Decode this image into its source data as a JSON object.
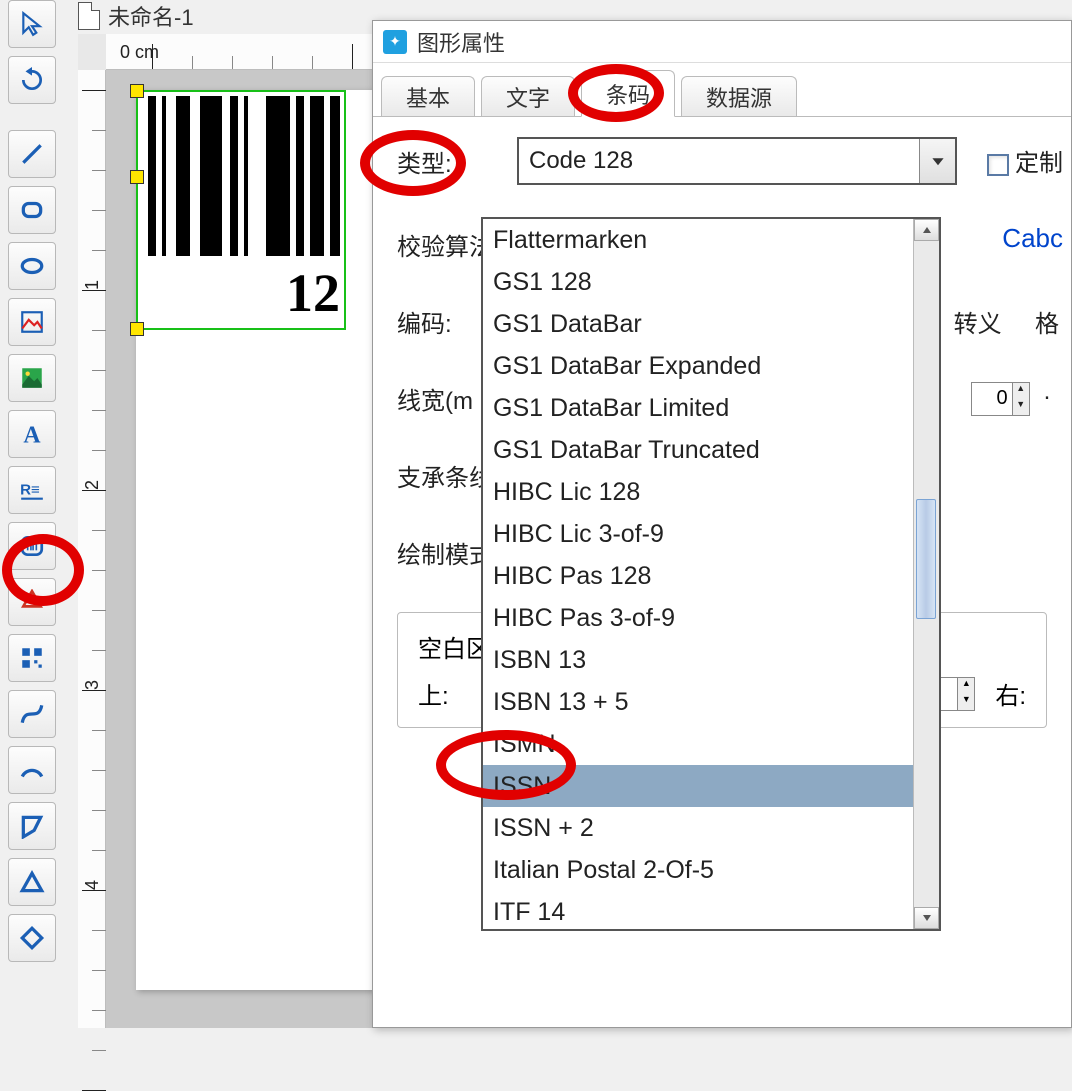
{
  "document": {
    "title": "未命名-1"
  },
  "ruler": {
    "unit_label": "0 cm",
    "marks_v": [
      "1",
      "2",
      "3",
      "4"
    ]
  },
  "barcode_object": {
    "text": "12"
  },
  "dialog": {
    "title": "图形属性",
    "tabs": {
      "basic": "基本",
      "text": "文字",
      "barcode": "条码",
      "datasource": "数据源"
    },
    "labels": {
      "type": "类型:",
      "custom": "定制",
      "check": "校验算法",
      "encode": "编码:",
      "linewidth": "线宽(m",
      "bearer": "支承条线",
      "drawmode": "绘制模式",
      "blank": "空白区",
      "top": "上:",
      "escape": "转义",
      "format": "格",
      "right": "右:",
      "cabc": "Cabc"
    },
    "combo_value": "Code 128",
    "spinner_value": "0",
    "dropdown_items": [
      "Flattermarken",
      "GS1 128",
      "GS1 DataBar",
      "GS1 DataBar Expanded",
      "GS1 DataBar Limited",
      "GS1 DataBar Truncated",
      "HIBC Lic 128",
      "HIBC Lic 3-of-9",
      "HIBC Pas 128",
      "HIBC Pas 3-of-9",
      "ISBN 13",
      "ISBN 13 + 5",
      "ISMN",
      "ISSN",
      "ISSN + 2",
      "Italian Postal 2-Of-5",
      "ITF 14"
    ],
    "highlight": "ISSN"
  },
  "toolbar_icons": [
    "cursor-icon",
    "redo-icon",
    "line-icon",
    "rounded-rect-icon",
    "ellipse-icon",
    "image-frame-icon",
    "picture-icon",
    "text-icon",
    "format-text-icon",
    "barcode-icon",
    "stamp-icon",
    "qr-icon",
    "curve-icon",
    "arc-icon",
    "polygon-icon",
    "triangle-icon",
    "diamond-icon"
  ]
}
